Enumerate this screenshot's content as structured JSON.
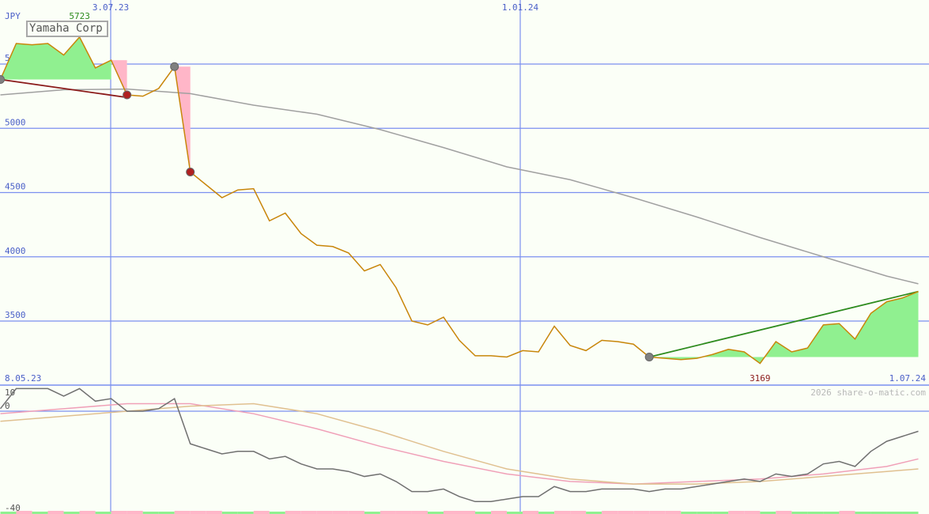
{
  "chart_data": [
    {
      "type": "line",
      "title": "Yamaha Corp",
      "currency_label": "JPY",
      "watermark": "2026 share-o-matic.com",
      "ylim": [
        3100,
        5850
      ],
      "y_ticks": [
        3500,
        4000,
        4500,
        5000,
        5500
      ],
      "y_tick_labels": [
        "3500",
        "4000",
        "4500",
        "5000",
        "5500"
      ],
      "x_grid_top_labels": [
        "3.07.23",
        "1.01.24"
      ],
      "x_range_labels": {
        "start": "8.05.23",
        "end": "1.07.24"
      },
      "max_label": "5723",
      "min_label": "3169",
      "grid": true,
      "series": [
        {
          "name": "",
          "color": "#c8860a",
          "x": [
            0,
            1,
            2,
            3,
            4,
            5,
            6,
            7,
            8,
            9,
            10,
            11,
            12,
            13,
            14,
            15,
            16,
            17,
            18,
            19,
            20,
            21,
            22,
            23,
            24,
            25,
            26,
            27,
            28,
            29,
            30,
            31,
            32,
            33,
            34,
            35,
            36,
            37,
            38,
            39,
            40,
            41,
            42,
            43,
            44,
            45,
            46,
            47,
            48,
            49,
            50,
            51,
            52,
            53,
            54,
            55,
            56,
            57,
            58
          ],
          "values": [
            5380,
            5660,
            5650,
            5660,
            5570,
            5710,
            5470,
            5530,
            5260,
            5250,
            5310,
            5480,
            4660,
            4560,
            4460,
            4520,
            4530,
            4280,
            4340,
            4180,
            4090,
            4080,
            4030,
            3890,
            3940,
            3760,
            3500,
            3470,
            3530,
            3350,
            3230,
            3230,
            3220,
            3270,
            3260,
            3460,
            3310,
            3270,
            3350,
            3340,
            3320,
            3220,
            3210,
            3200,
            3210,
            3240,
            3280,
            3260,
            3170,
            3340,
            3260,
            3290,
            3470,
            3480,
            3360,
            3560,
            3650,
            3680,
            3730
          ]
        },
        {
          "name": "",
          "color": "#a0a0a0",
          "x": [
            0,
            4,
            8,
            12,
            16,
            20,
            24,
            28,
            32,
            36,
            40,
            44,
            48,
            52,
            56,
            58
          ],
          "values": [
            5260,
            5300,
            5305,
            5270,
            5180,
            5110,
            4990,
            4850,
            4700,
            4600,
            4460,
            4310,
            4150,
            4000,
            3850,
            3790
          ]
        },
        {
          "name": "",
          "color": "#8b1a1a",
          "x": [
            0,
            8
          ],
          "values": [
            5380,
            5240
          ]
        },
        {
          "name": "",
          "color": "#2e8b1f",
          "x": [
            41,
            58
          ],
          "values": [
            3220,
            3730
          ]
        }
      ]
    },
    {
      "type": "line",
      "ylim": [
        -40,
        10
      ],
      "y_tick_labels": [
        "10",
        "0",
        "-40"
      ],
      "grid": true,
      "series": [
        {
          "name": "",
          "color": "#707070",
          "x": [
            0,
            1,
            2,
            3,
            4,
            5,
            6,
            7,
            8,
            9,
            10,
            11,
            12,
            13,
            14,
            15,
            16,
            17,
            18,
            19,
            20,
            21,
            22,
            23,
            24,
            25,
            26,
            27,
            28,
            29,
            30,
            31,
            32,
            33,
            34,
            35,
            36,
            37,
            38,
            39,
            40,
            41,
            42,
            43,
            44,
            45,
            46,
            47,
            48,
            49,
            50,
            51,
            52,
            53,
            54,
            55,
            56,
            57,
            58
          ],
          "values": [
            1,
            9,
            9,
            9,
            6,
            9,
            4,
            5,
            0,
            0,
            1,
            5,
            -13,
            -15,
            -17,
            -16,
            -16,
            -19,
            -18,
            -21,
            -23,
            -23,
            -24,
            -26,
            -25,
            -28,
            -32,
            -32,
            -31,
            -34,
            -36,
            -36,
            -35,
            -34,
            -34,
            -30,
            -32,
            -32,
            -31,
            -31,
            -31,
            -32,
            -31,
            -31,
            -30,
            -29,
            -28,
            -27,
            -28,
            -25,
            -26,
            -25,
            -21,
            -20,
            -22,
            -16,
            -12,
            -10,
            -8
          ]
        },
        {
          "name": "",
          "color": "#f0a0b8",
          "x": [
            0,
            4,
            8,
            12,
            16,
            20,
            24,
            28,
            32,
            36,
            40,
            44,
            48,
            52,
            56,
            58
          ],
          "values": [
            -1,
            1,
            3,
            3,
            -1,
            -7,
            -14,
            -20,
            -25,
            -28,
            -29,
            -28,
            -27,
            -25,
            -22,
            -19
          ]
        },
        {
          "name": "",
          "color": "#e0c090",
          "x": [
            0,
            4,
            8,
            12,
            16,
            20,
            24,
            28,
            32,
            36,
            40,
            44,
            48,
            52,
            56,
            58
          ],
          "values": [
            -4,
            -2,
            0,
            2,
            3,
            -1,
            -8,
            -16,
            -23,
            -27,
            -29,
            -29,
            -28,
            -26,
            -24,
            -23
          ]
        }
      ]
    }
  ],
  "colors": {
    "background": "#fbfff7",
    "grid": "#7b8ff0",
    "axis_text": "#4a5fc8",
    "gain_fill": "#90f090",
    "loss_fill": "#ffb6c8",
    "max_text": "#2e8b1f",
    "min_text": "#8b1a1a"
  }
}
